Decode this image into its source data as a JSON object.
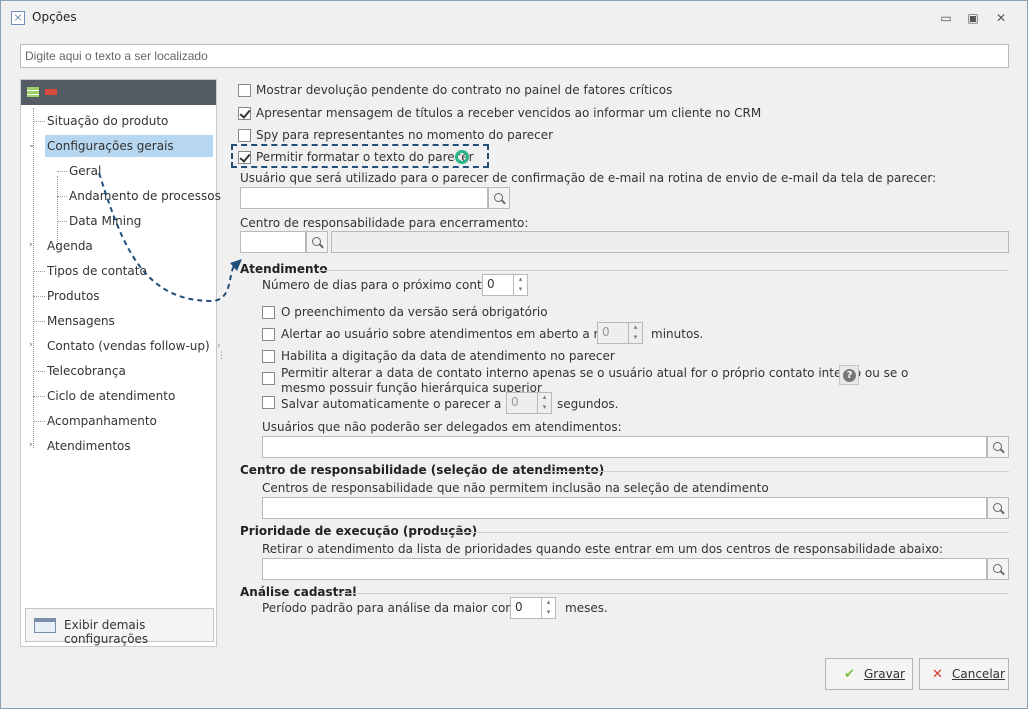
{
  "window": {
    "title": "Opções",
    "controls": [
      "▭",
      "▣",
      "✕"
    ]
  },
  "search": {
    "placeholder": "Digite aqui o texto a ser localizado"
  },
  "tree": {
    "items": [
      {
        "label": "Situação do produto"
      },
      {
        "label": "Configurações gerais"
      },
      {
        "label": "Geral"
      },
      {
        "label": "Andamento de processos"
      },
      {
        "label": "Data Mining"
      },
      {
        "label": "Agenda"
      },
      {
        "label": "Tipos de contato"
      },
      {
        "label": "Produtos"
      },
      {
        "label": "Mensagens"
      },
      {
        "label": "Contato (vendas follow-up)"
      },
      {
        "label": "Telecobrança"
      },
      {
        "label": "Ciclo de atendimento"
      },
      {
        "label": "Acompanhamento"
      },
      {
        "label": "Atendimentos"
      }
    ],
    "more_button": "Exibir demais configurações"
  },
  "options": {
    "show_pending_return": {
      "label": "Mostrar devolução pendente do contrato no painel de fatores críticos",
      "checked": false
    },
    "show_overdue_titles": {
      "label": "Apresentar mensagem de títulos a receber vencidos ao informar um cliente no CRM",
      "checked": true
    },
    "spy_representatives": {
      "label": "Spy para representantes no  momento do parecer",
      "checked": false
    },
    "allow_format_text": {
      "label": "Permitir formatar o texto do parecer",
      "checked": true
    },
    "email_user_label": "Usuário que será utilizado para o parecer de confirmação de e-mail na rotina de envio de e-mail da tela de parecer:",
    "closing_center_label": "Centro de responsabilidade para encerramento:"
  },
  "atendimento": {
    "title": "Atendimento",
    "days_label": "Número de dias para o próximo contato:",
    "days_value": "0",
    "version_required": {
      "label": "O preenchimento da versão será obrigatório",
      "checked": false
    },
    "alert_open": {
      "label": "Alertar ao usuário sobre atendimentos em aberto a mais de",
      "value": "0",
      "suffix": "minutos.",
      "checked": false
    },
    "enable_date": {
      "label": "Habilita a digitação da data de atendimento no parecer",
      "checked": false
    },
    "allow_change_date": {
      "label": "Permitir alterar a data de contato interno apenas se o usuário atual for o próprio contato interno ou se o",
      "label2": "mesmo possuir função hierárquica superior",
      "checked": false
    },
    "autosave": {
      "label": "Salvar automaticamente o parecer a cada",
      "value": "0",
      "suffix": "segundos.",
      "checked": false
    },
    "not_delegated_label": "Usuários que não poderão ser delegados em atendimentos:"
  },
  "centro": {
    "title": "Centro de responsabilidade (seleção de atendimento)",
    "label": "Centros de responsabilidade que não permitem inclusão na seleção de atendimento"
  },
  "prioridade": {
    "title": "Prioridade de execução (produção)",
    "label": "Retirar o atendimento da lista de prioridades quando este entrar em um dos centros de responsabilidade abaixo:"
  },
  "analise": {
    "title": "Análise cadastral",
    "period_label": "Período padrão para análise da maior compra:",
    "period_value": "0",
    "period_suffix": "meses."
  },
  "buttons": {
    "save": "Gravar",
    "cancel": "Cancelar"
  },
  "colors": {
    "selection": "#b7d6ef",
    "highlight": "#1f4f7a",
    "green": "#2ab58a",
    "save_icon": "#7cbf3a",
    "cancel_icon": "#d33a2f"
  }
}
